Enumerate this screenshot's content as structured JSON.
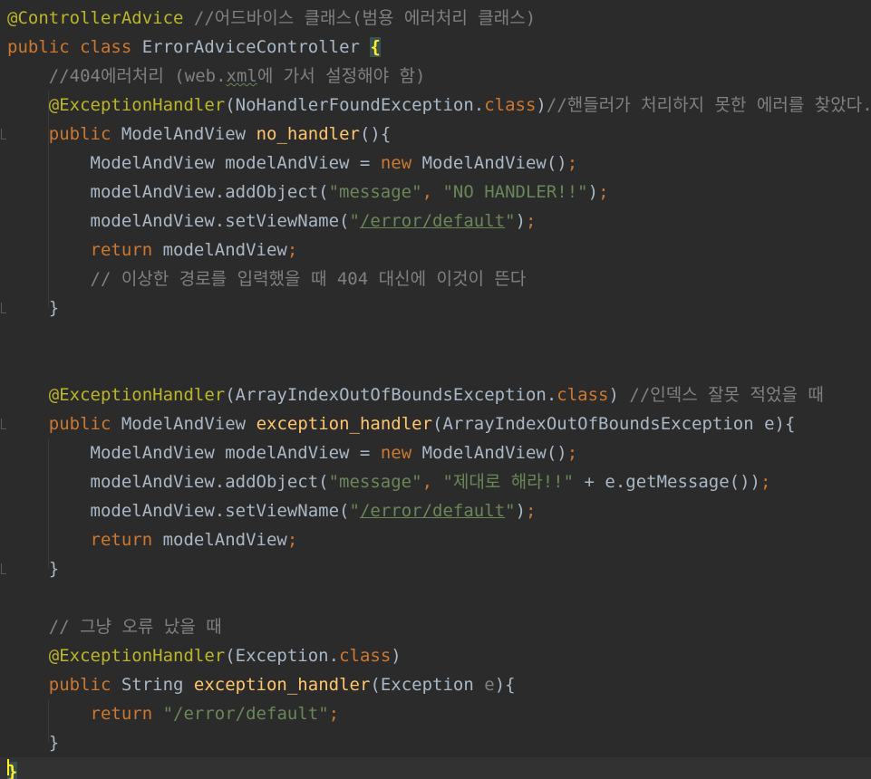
{
  "editor": {
    "lines": [
      [
        {
          "t": "@ControllerAdvice",
          "c": "ann"
        },
        {
          "t": " ",
          "c": ""
        },
        {
          "t": "//어드바이스 클래스(범용 에러처리 클래스)",
          "c": "cmt"
        }
      ],
      [
        {
          "t": "public",
          "c": "kw"
        },
        {
          "t": " ",
          "c": ""
        },
        {
          "t": "class",
          "c": "kw"
        },
        {
          "t": " ErrorAdviceController ",
          "c": ""
        },
        {
          "t": "{",
          "c": "brace-hl"
        }
      ],
      [
        {
          "t": "    //404에러처리 (web.",
          "c": "cmt"
        },
        {
          "t": "xml",
          "c": "cmt wavy"
        },
        {
          "t": "에 가서 설정해야 함)",
          "c": "cmt"
        }
      ],
      [
        {
          "t": "    ",
          "c": ""
        },
        {
          "t": "@ExceptionHandler",
          "c": "ann"
        },
        {
          "t": "(NoHandlerFoundException.",
          "c": ""
        },
        {
          "t": "class",
          "c": "kw"
        },
        {
          "t": ")",
          "c": ""
        },
        {
          "t": "//핸들러가 처리하지 못한 에러를 찾았다.",
          "c": "cmt"
        }
      ],
      [
        {
          "t": "    ",
          "c": ""
        },
        {
          "t": "public",
          "c": "kw"
        },
        {
          "t": " ModelAndView ",
          "c": ""
        },
        {
          "t": "no_handler",
          "c": "fn"
        },
        {
          "t": "(){",
          "c": ""
        }
      ],
      [
        {
          "t": "        ModelAndView modelAndView = ",
          "c": ""
        },
        {
          "t": "new",
          "c": "kw"
        },
        {
          "t": " ModelAndView()",
          "c": ""
        },
        {
          "t": ";",
          "c": "kw"
        }
      ],
      [
        {
          "t": "        modelAndView.addObject(",
          "c": ""
        },
        {
          "t": "\"message\"",
          "c": "str"
        },
        {
          "t": ", ",
          "c": "kw"
        },
        {
          "t": "\"NO HANDLER!!\"",
          "c": "str"
        },
        {
          "t": ")",
          "c": ""
        },
        {
          "t": ";",
          "c": "kw"
        }
      ],
      [
        {
          "t": "        modelAndView.setViewName(",
          "c": ""
        },
        {
          "t": "\"",
          "c": "str"
        },
        {
          "t": "/error/default",
          "c": "str ul"
        },
        {
          "t": "\"",
          "c": "str"
        },
        {
          "t": ")",
          "c": ""
        },
        {
          "t": ";",
          "c": "kw"
        }
      ],
      [
        {
          "t": "        ",
          "c": ""
        },
        {
          "t": "return",
          "c": "kw"
        },
        {
          "t": " modelAndView",
          "c": ""
        },
        {
          "t": ";",
          "c": "kw"
        }
      ],
      [
        {
          "t": "        // 이상한 경로를 입력했을 때 404 대신에 이것이 뜬다",
          "c": "cmt"
        }
      ],
      [
        {
          "t": "    }",
          "c": ""
        }
      ],
      [],
      [],
      [
        {
          "t": "    ",
          "c": ""
        },
        {
          "t": "@ExceptionHandler",
          "c": "ann"
        },
        {
          "t": "(ArrayIndexOutOfBoundsException.",
          "c": ""
        },
        {
          "t": "class",
          "c": "kw"
        },
        {
          "t": ") ",
          "c": ""
        },
        {
          "t": "//인덱스 잘못 적었을 때",
          "c": "cmt"
        }
      ],
      [
        {
          "t": "    ",
          "c": ""
        },
        {
          "t": "public",
          "c": "kw"
        },
        {
          "t": " ModelAndView ",
          "c": ""
        },
        {
          "t": "exception_handler",
          "c": "fn"
        },
        {
          "t": "(ArrayIndexOutOfBoundsException e){",
          "c": ""
        }
      ],
      [
        {
          "t": "        ModelAndView modelAndView = ",
          "c": ""
        },
        {
          "t": "new",
          "c": "kw"
        },
        {
          "t": " ModelAndView()",
          "c": ""
        },
        {
          "t": ";",
          "c": "kw"
        }
      ],
      [
        {
          "t": "        modelAndView.addObject(",
          "c": ""
        },
        {
          "t": "\"message\"",
          "c": "str"
        },
        {
          "t": ", ",
          "c": "kw"
        },
        {
          "t": "\"제대로 해라!!\"",
          "c": "str"
        },
        {
          "t": " + e.getMessage())",
          "c": ""
        },
        {
          "t": ";",
          "c": "kw"
        }
      ],
      [
        {
          "t": "        modelAndView.setViewName(",
          "c": ""
        },
        {
          "t": "\"",
          "c": "str"
        },
        {
          "t": "/error/default",
          "c": "str ul"
        },
        {
          "t": "\"",
          "c": "str"
        },
        {
          "t": ")",
          "c": ""
        },
        {
          "t": ";",
          "c": "kw"
        }
      ],
      [
        {
          "t": "        ",
          "c": ""
        },
        {
          "t": "return",
          "c": "kw"
        },
        {
          "t": " modelAndView",
          "c": ""
        },
        {
          "t": ";",
          "c": "kw"
        }
      ],
      [
        {
          "t": "    }",
          "c": ""
        }
      ],
      [],
      [
        {
          "t": "    // 그냥 오류 났을 때",
          "c": "cmt"
        }
      ],
      [
        {
          "t": "    ",
          "c": ""
        },
        {
          "t": "@ExceptionHandler",
          "c": "ann"
        },
        {
          "t": "(Exception.",
          "c": ""
        },
        {
          "t": "class",
          "c": "kw"
        },
        {
          "t": ")",
          "c": ""
        }
      ],
      [
        {
          "t": "    ",
          "c": ""
        },
        {
          "t": "public",
          "c": "kw"
        },
        {
          "t": " String ",
          "c": ""
        },
        {
          "t": "exception_handler",
          "c": "fn"
        },
        {
          "t": "(Exception ",
          "c": ""
        },
        {
          "t": "e",
          "c": "cmt"
        },
        {
          "t": "){",
          "c": ""
        }
      ],
      [
        {
          "t": "        ",
          "c": ""
        },
        {
          "t": "return",
          "c": "kw"
        },
        {
          "t": " ",
          "c": ""
        },
        {
          "t": "\"/error/default\"",
          "c": "str"
        },
        {
          "t": ";",
          "c": "kw"
        }
      ],
      [
        {
          "t": "    }",
          "c": ""
        }
      ],
      [
        {
          "t": "}",
          "c": "brace-hl"
        }
      ]
    ],
    "current_line": 26
  }
}
